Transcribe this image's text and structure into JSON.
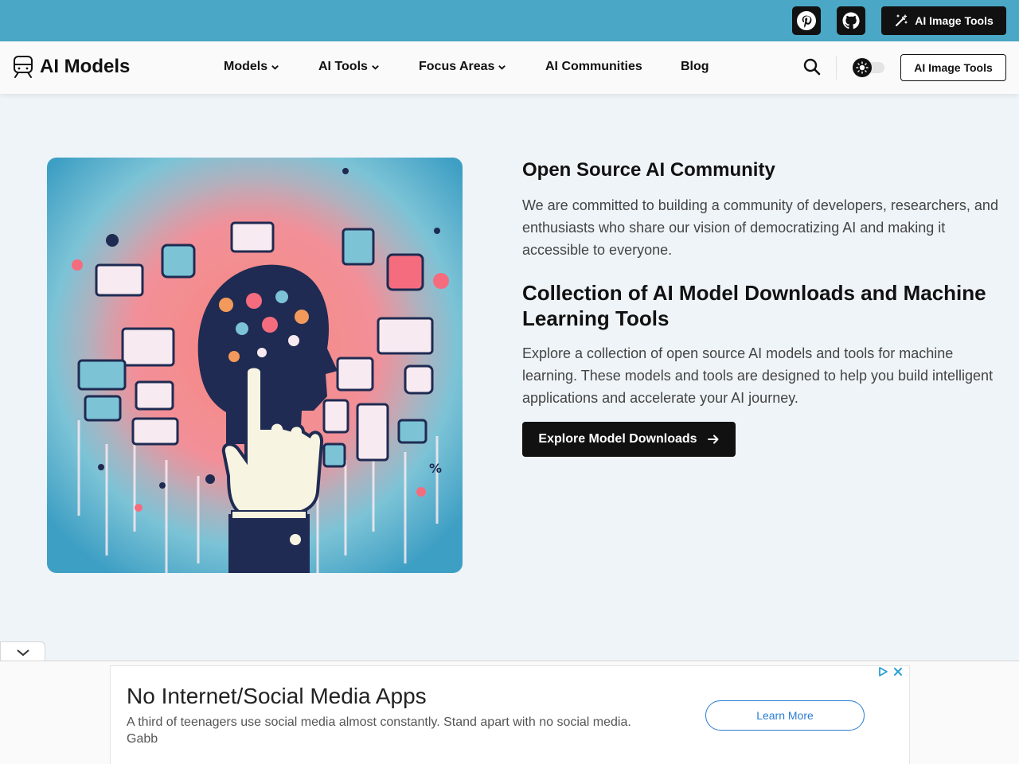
{
  "topbar": {
    "pinterest_icon": "pinterest-icon",
    "github_icon": "github-icon",
    "cta_label": "AI Image Tools",
    "cta_icon": "magic-wand-icon",
    "bg_color": "#4aa8c6"
  },
  "nav": {
    "logo_icon": "train-icon",
    "logo_text": "AI Models",
    "items": [
      {
        "label": "Models",
        "dropdown": true
      },
      {
        "label": "AI Tools",
        "dropdown": true
      },
      {
        "label": "Focus Areas",
        "dropdown": true
      },
      {
        "label": "AI Communities",
        "dropdown": false
      },
      {
        "label": "Blog",
        "dropdown": false
      }
    ],
    "search_icon": "search-icon",
    "theme_toggle_icon": "sun-icon",
    "cta_label": "AI Image Tools"
  },
  "hero": {
    "image_icon": "ai-brain-illustration",
    "heading1": "Open Source AI Community",
    "paragraph1": "We are committed to building a community of developers, researchers, and enthusiasts who share our vision of democratizing AI and making it accessible to everyone.",
    "heading2": "Collection of AI Model Downloads and Machine Learning Tools",
    "paragraph2": "Explore a collection of open source AI models and tools for machine learning. These models and tools are designed to help you build intelligent applications and accelerate your AI journey.",
    "cta_label": "Explore Model Downloads",
    "cta_icon": "arrow-right-icon"
  },
  "ad": {
    "collapse_icon": "chevron-down-icon",
    "title": "No Internet/Social Media Apps",
    "description": "A third of teenagers use social media almost constantly. Stand apart with no social media.",
    "advertiser": "Gabb",
    "cta_label": "Learn More",
    "adchoices_icon": "adchoices-icon",
    "close_icon": "close-icon",
    "accent_color": "#2a7dd2"
  }
}
